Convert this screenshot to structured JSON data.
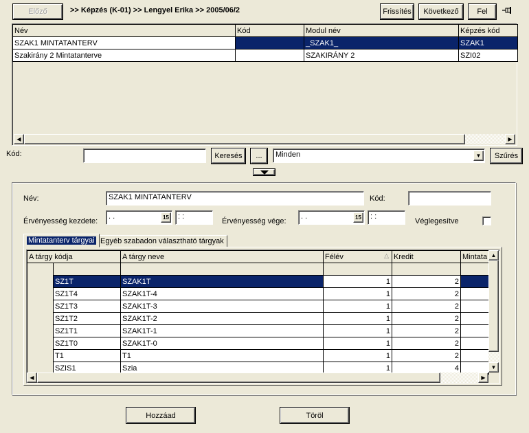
{
  "toolbar": {
    "prev_label": "Előző",
    "breadcrumb": ">> Képzés (K-01) >> Lengyel Erika >> 2005/06/2",
    "refresh_label": "Frissítés",
    "next_label": "Következő",
    "up_label": "Fel",
    "pin_icon": "pin-icon"
  },
  "top_grid": {
    "columns": [
      "Név",
      "Kód",
      "Modul név",
      "Képzés kód"
    ],
    "rows": [
      [
        "SZAK1 MINTATANTERV",
        "",
        "_SZAK1_",
        "SZAK1"
      ],
      [
        "Szakirány 2 Mintatanterve",
        "",
        "SZAKIRÁNY 2",
        "SZI02"
      ]
    ]
  },
  "search": {
    "kod_label": "Kód:",
    "kod_value": "",
    "search_label": "Keresés",
    "browse_label": "...",
    "filter_value": "Minden",
    "filter_label": "Szűrés"
  },
  "splitter_icon": "triangle-down-icon",
  "detail": {
    "nev_label": "Név:",
    "nev_value": "SZAK1 MINTATANTERV",
    "kod_label": "Kód:",
    "kod_value": "",
    "start_label": "Érvényesség kezdete:",
    "start_date": " .  .",
    "start_time": " :  :",
    "end_label": "Érvényesség vége:",
    "end_date": " .  .",
    "end_time": " :  :",
    "calendar_glyph": "15",
    "final_label": "Véglegesítve"
  },
  "tabs": [
    {
      "label": "Mintatanterv tárgyai"
    },
    {
      "label": "Egyéb szabadon választható tárgyak"
    }
  ],
  "subject_grid": {
    "columns": [
      "A tárgy kódja",
      "A tárgy neve",
      "Félév",
      "Kredit",
      "Mintata"
    ],
    "sort_indicator": "△",
    "rows": [
      [
        "SZ1T",
        "SZAK1T",
        "1",
        "2",
        ""
      ],
      [
        "SZ1T4",
        "SZAK1T-4",
        "1",
        "2",
        ""
      ],
      [
        "SZ1T3",
        "SZAK1T-3",
        "1",
        "2",
        ""
      ],
      [
        "SZ1T2",
        "SZAK1T-2",
        "1",
        "2",
        ""
      ],
      [
        "SZ1T1",
        "SZAK1T-1",
        "1",
        "2",
        ""
      ],
      [
        "SZ1T0",
        "SZAK1T-0",
        "1",
        "2",
        ""
      ],
      [
        "T1",
        "T1",
        "1",
        "2",
        ""
      ],
      [
        "SZIS1",
        "Szia",
        "1",
        "4",
        ""
      ]
    ]
  },
  "footer": {
    "add_label": "Hozzáad",
    "delete_label": "Töröl"
  }
}
